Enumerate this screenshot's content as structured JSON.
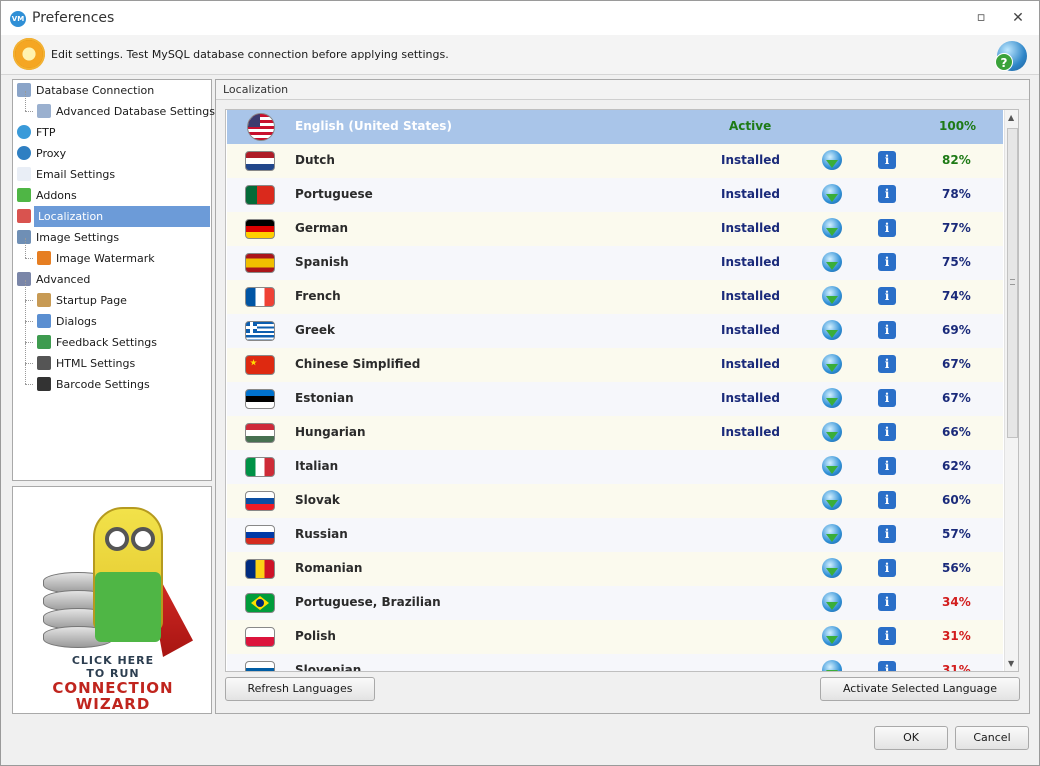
{
  "window": {
    "title": "Preferences",
    "restore_glyph": "▫",
    "close_glyph": "✕"
  },
  "infobar": {
    "text": "Edit settings. Test MySQL database connection before applying settings.",
    "help_glyph": "?"
  },
  "tree": {
    "items": [
      {
        "label": "Database Connection",
        "icon": "database-icon",
        "level": 0
      },
      {
        "label": "Advanced Database Settings",
        "icon": "database-settings-icon",
        "level": 1
      },
      {
        "label": "FTP",
        "icon": "ftp-globe-icon",
        "level": 0
      },
      {
        "label": "Proxy",
        "icon": "proxy-globe-icon",
        "level": 0
      },
      {
        "label": "Email Settings",
        "icon": "email-icon",
        "level": 0
      },
      {
        "label": "Addons",
        "icon": "puzzle-icon",
        "level": 0
      },
      {
        "label": "Localization",
        "icon": "localization-icon",
        "level": 0,
        "selected": true
      },
      {
        "label": "Image Settings",
        "icon": "image-icon",
        "level": 0
      },
      {
        "label": "Image Watermark",
        "icon": "watermark-icon",
        "level": 1
      },
      {
        "label": "Advanced",
        "icon": "shield-icon",
        "level": 0
      },
      {
        "label": "Startup Page",
        "icon": "home-icon",
        "level": 1
      },
      {
        "label": "Dialogs",
        "icon": "dialog-icon",
        "level": 1
      },
      {
        "label": "Feedback Settings",
        "icon": "chart-icon",
        "level": 1
      },
      {
        "label": "HTML Settings",
        "icon": "html-icon",
        "level": 1
      },
      {
        "label": "Barcode Settings",
        "icon": "barcode-icon",
        "level": 1
      }
    ]
  },
  "wizard": {
    "line1": "CLICK HERE",
    "line2": "TO RUN",
    "line3": "CONNECTION",
    "line4": "WIZARD"
  },
  "panel": {
    "title": "Localization"
  },
  "languages": [
    {
      "name": "English (United States)",
      "status": "Active",
      "percent": "100%",
      "flag": "us",
      "active": true,
      "pct_color": "green"
    },
    {
      "name": "Dutch",
      "status": "Installed",
      "percent": "82%",
      "flag": "nl",
      "pct_color": "green"
    },
    {
      "name": "Portuguese",
      "status": "Installed",
      "percent": "78%",
      "flag": "pt",
      "pct_color": "blue"
    },
    {
      "name": "German",
      "status": "Installed",
      "percent": "77%",
      "flag": "de",
      "pct_color": "blue"
    },
    {
      "name": "Spanish",
      "status": "Installed",
      "percent": "75%",
      "flag": "es",
      "pct_color": "blue"
    },
    {
      "name": "French",
      "status": "Installed",
      "percent": "74%",
      "flag": "fr",
      "pct_color": "blue"
    },
    {
      "name": "Greek",
      "status": "Installed",
      "percent": "69%",
      "flag": "gr",
      "pct_color": "blue"
    },
    {
      "name": "Chinese Simplified",
      "status": "Installed",
      "percent": "67%",
      "flag": "cn",
      "pct_color": "blue"
    },
    {
      "name": "Estonian",
      "status": "Installed",
      "percent": "67%",
      "flag": "ee",
      "pct_color": "blue"
    },
    {
      "name": "Hungarian",
      "status": "Installed",
      "percent": "66%",
      "flag": "hu",
      "pct_color": "blue"
    },
    {
      "name": "Italian",
      "status": "",
      "percent": "62%",
      "flag": "it",
      "pct_color": "blue"
    },
    {
      "name": "Slovak",
      "status": "",
      "percent": "60%",
      "flag": "sk",
      "pct_color": "blue"
    },
    {
      "name": "Russian",
      "status": "",
      "percent": "57%",
      "flag": "ru",
      "pct_color": "blue"
    },
    {
      "name": "Romanian",
      "status": "",
      "percent": "56%",
      "flag": "ro",
      "pct_color": "blue"
    },
    {
      "name": "Portuguese, Brazilian",
      "status": "",
      "percent": "34%",
      "flag": "br",
      "pct_color": "red"
    },
    {
      "name": "Polish",
      "status": "",
      "percent": "31%",
      "flag": "pl",
      "pct_color": "red"
    },
    {
      "name": "Slovenian",
      "status": "",
      "percent": "31%",
      "flag": "si",
      "pct_color": "red"
    }
  ],
  "buttons": {
    "refresh": "Refresh Languages",
    "activate": "Activate Selected Language",
    "ok": "OK",
    "cancel": "Cancel"
  },
  "colors": {
    "selected_row": "#a9c5e9",
    "tree_selection": "#6c9bd8",
    "status_blue": "#1a2a7a",
    "active_green": "#1e7a16",
    "low_red": "#d21d1d"
  }
}
